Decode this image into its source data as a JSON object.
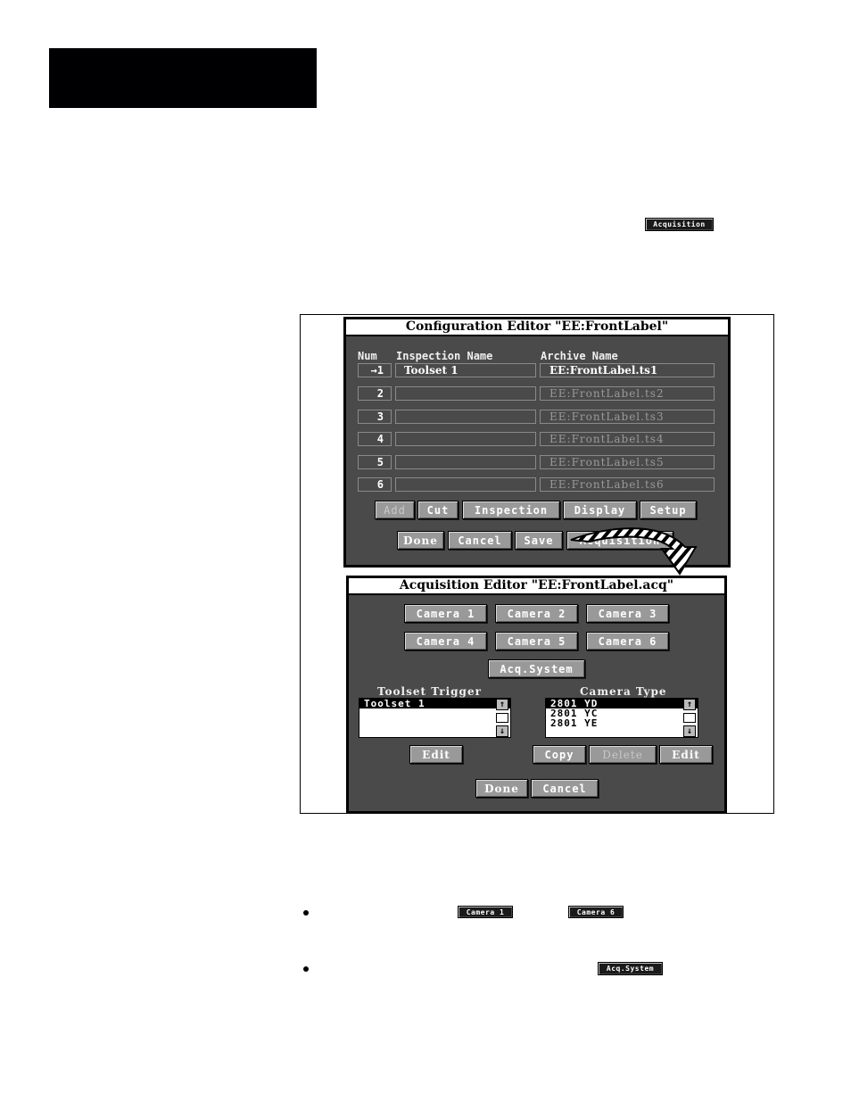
{
  "inline_buttons": {
    "acquisition": "Acquisition",
    "camera1": "Camera 1",
    "camera6": "Camera 6",
    "acq_system": "Acq.System"
  },
  "config_editor": {
    "title": "Configuration Editor \"EE:FrontLabel\"",
    "columns": {
      "num": "Num",
      "inspection_name": "Inspection Name",
      "archive_name": "Archive Name"
    },
    "rows": [
      {
        "num": "→1",
        "inspection": "Toolset 1",
        "archive": "EE:FrontLabel.ts1",
        "active": true
      },
      {
        "num": "2",
        "inspection": "",
        "archive": "EE:FrontLabel.ts2",
        "active": false
      },
      {
        "num": "3",
        "inspection": "",
        "archive": "EE:FrontLabel.ts3",
        "active": false
      },
      {
        "num": "4",
        "inspection": "",
        "archive": "EE:FrontLabel.ts4",
        "active": false
      },
      {
        "num": "5",
        "inspection": "",
        "archive": "EE:FrontLabel.ts5",
        "active": false
      },
      {
        "num": "6",
        "inspection": "",
        "archive": "EE:FrontLabel.ts6",
        "active": false
      }
    ],
    "buttons_row1": {
      "add": "Add",
      "cut": "Cut",
      "inspection": "Inspection",
      "display": "Display",
      "setup": "Setup"
    },
    "buttons_row2": {
      "done": "Done",
      "cancel": "Cancel",
      "save": "Save",
      "acquisition": "Acquisition"
    }
  },
  "acq_editor": {
    "title": "Acquisition Editor \"EE:FrontLabel.acq\"",
    "cameras": [
      "Camera 1",
      "Camera 2",
      "Camera 3",
      "Camera 4",
      "Camera 5",
      "Camera 6"
    ],
    "acq_system": "Acq.System",
    "toolset_trigger": {
      "label": "Toolset Trigger",
      "items": [
        "Toolset 1"
      ],
      "selected": 0,
      "edit": "Edit"
    },
    "camera_type": {
      "label": "Camera Type",
      "items": [
        "2801 YD",
        "2801 YC",
        "2801 YE"
      ],
      "selected": 0,
      "copy": "Copy",
      "delete": "Delete",
      "edit": "Edit"
    },
    "done": "Done",
    "cancel": "Cancel"
  },
  "icons": {
    "scroll_up": "↑",
    "scroll_down": "↓"
  }
}
